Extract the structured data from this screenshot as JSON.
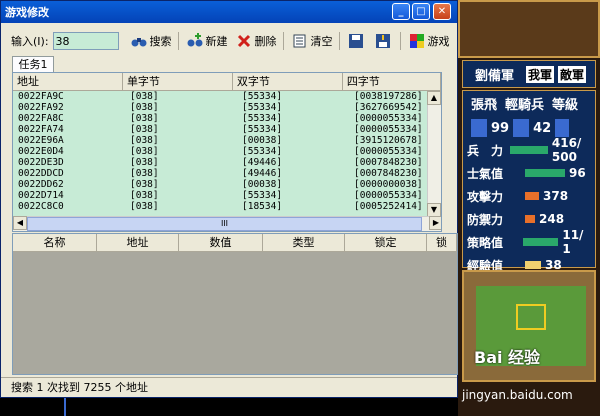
{
  "window": {
    "title": "游戏修改",
    "controls": [
      "_",
      "□",
      "✕"
    ]
  },
  "toolbar": {
    "input_label": "输入(I):",
    "input_value": "38",
    "search_label": "搜索",
    "new_label": "新建",
    "delete_label": "删除",
    "clear_label": "清空",
    "game_label": "游戏"
  },
  "tab": {
    "label": "任务1"
  },
  "results": {
    "columns": [
      "地址",
      "单字节",
      "双字节",
      "四字节"
    ],
    "rows": [
      [
        "0022FA9C",
        "[038]",
        "[55334]",
        "[0038197286]"
      ],
      [
        "0022FA92",
        "[038]",
        "[55334]",
        "[3627669542]"
      ],
      [
        "0022FA8C",
        "[038]",
        "[55334]",
        "[0000055334]"
      ],
      [
        "0022FA74",
        "[038]",
        "[55334]",
        "[0000055334]"
      ],
      [
        "0022E96A",
        "[038]",
        "[00038]",
        "[3915120678]"
      ],
      [
        "0022E0D4",
        "[038]",
        "[55334]",
        "[0000055334]"
      ],
      [
        "0022DE3D",
        "[038]",
        "[49446]",
        "[0007848230]"
      ],
      [
        "0022DDCD",
        "[038]",
        "[49446]",
        "[0007848230]"
      ],
      [
        "0022DD62",
        "[038]",
        "[00038]",
        "[0000000038]"
      ],
      [
        "0022D714",
        "[038]",
        "[55334]",
        "[0000055334]"
      ],
      [
        "0022C8C0",
        "[038]",
        "[18534]",
        "[0005252414]"
      ]
    ],
    "hscroll_mark": "III"
  },
  "watch": {
    "columns": [
      "名称",
      "地址",
      "数值",
      "类型",
      "锁定",
      "锁"
    ]
  },
  "status": {
    "text": "搜索 1 次找到 7255 个地址"
  },
  "game": {
    "commander": "劉備軍",
    "tab_mine": "我軍",
    "tab_enemy": "敵軍",
    "unit_name": "張飛",
    "unit_type": "輕騎兵",
    "level_label": "等級",
    "stat_a": "99",
    "stat_b": "42",
    "stats": [
      {
        "label": "兵　力",
        "value": "416/ 500"
      },
      {
        "label": "士氣值",
        "value": "96"
      },
      {
        "label": "攻擊力",
        "value": "378"
      },
      {
        "label": "防禦力",
        "value": "248"
      },
      {
        "label": "策略值",
        "value": "11/ 1"
      },
      {
        "label": "經驗值",
        "value": "38"
      }
    ],
    "watermark": "Bai 经验",
    "url": "jingyan.baidu.com"
  }
}
